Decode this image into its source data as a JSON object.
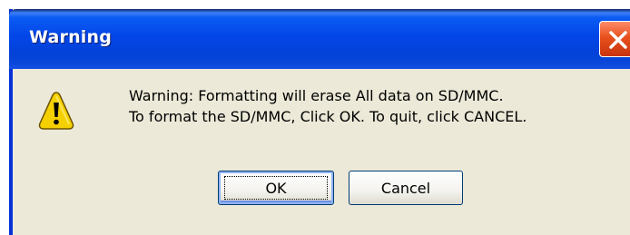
{
  "window": {
    "title": "Warning",
    "close_icon": "close-icon"
  },
  "dialog": {
    "icon": "warning-icon",
    "message_line1": "Warning: Formatting will erase All data on SD/MMC.",
    "message_line2": "To format the SD/MMC, Click OK. To quit, click CANCEL."
  },
  "buttons": {
    "ok_label": "OK",
    "cancel_label": "Cancel"
  },
  "colors": {
    "titlebar": "#0346e8",
    "dialog_bg": "#ece9d8",
    "close_button": "#e8501c",
    "warning_yellow": "#f5d000"
  }
}
